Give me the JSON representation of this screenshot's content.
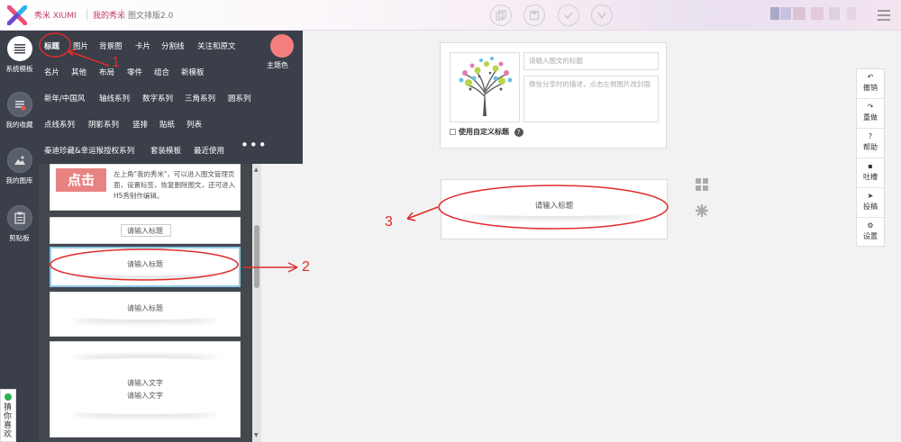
{
  "topbar": {
    "brand": "秀米 XIUMI",
    "my_xiumi": "我的秀米",
    "editor_name": "图文排版2.0",
    "accent": "#c0396a"
  },
  "sidebar": {
    "items": [
      {
        "label": "系统模板",
        "icon": "list-icon"
      },
      {
        "label": "我的收藏",
        "icon": "collection-icon"
      },
      {
        "label": "我的图库",
        "icon": "image-icon"
      },
      {
        "label": "剪贴板",
        "icon": "clipboard-icon"
      }
    ],
    "bg": "#3a3f49"
  },
  "categories": {
    "row1": [
      "标题",
      "图片",
      "背景图",
      "卡片",
      "分割线",
      "关注和原文"
    ],
    "row2": [
      "名片",
      "其他",
      "布局",
      "零件",
      "组合",
      "新模板"
    ],
    "row3": [
      "新年/中国风",
      "轴线系列",
      "数字系列",
      "三角系列",
      "圆系列"
    ],
    "row4": [
      "点线系列",
      "阴影系列",
      "竖排",
      "贴纸",
      "列表"
    ],
    "row5": [
      "秦迪珍藏&幸运猴授权系列",
      "套装模板",
      "最近使用"
    ],
    "more": "•••",
    "theme_label": "主题色",
    "theme_color": "#f47e7e"
  },
  "templates": {
    "dianji": "点击",
    "desc": "左上角\"我的秀米\"，可以进入图文管理页面，设置标签，恢复删除图文，还可进入H5秀制作编辑。",
    "title_placeholder": "请输入标题",
    "text_placeholder": "请输入文字"
  },
  "guess": "猜你喜欢",
  "editor": {
    "title_placeholder": "请输入图文的标题",
    "desc_placeholder": "微信分享时的描述，点击左侧图片改封面",
    "custom_title_label": "使用自定义标题",
    "help_glyph": "?",
    "block_title": "请输入标题"
  },
  "right_tools": [
    {
      "label": "撤销",
      "icon": "undo-icon",
      "glyph": "↶"
    },
    {
      "label": "重做",
      "icon": "redo-icon",
      "glyph": "↷"
    },
    {
      "label": "帮助",
      "icon": "help-icon",
      "glyph": "?"
    },
    {
      "label": "吐槽",
      "icon": "comment-icon",
      "glyph": "▪"
    },
    {
      "label": "投稿",
      "icon": "send-icon",
      "glyph": "➤"
    },
    {
      "label": "设置",
      "icon": "settings-icon",
      "glyph": "⚙"
    }
  ],
  "annotations": {
    "n1": "1",
    "n2": "2",
    "n3": "3",
    "color": "#e02c2c"
  }
}
